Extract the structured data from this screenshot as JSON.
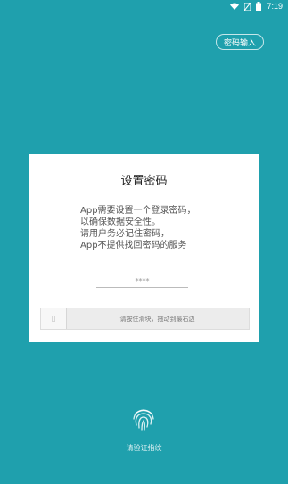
{
  "status_bar": {
    "time": "7:19",
    "icons": [
      "wifi-icon",
      "sim-icon",
      "battery-icon"
    ]
  },
  "header": {
    "password_input_label": "密码输入"
  },
  "dialog": {
    "title": "设置密码",
    "description_lines": [
      "App需要设置一个登录密码，",
      "以确保数据安全性。",
      "请用户务必记住密码，",
      "App不提供找回密码的服务"
    ],
    "password_masked": "****",
    "slider_label": "请按住滑块，拖动到最右边",
    "slider_handle_icon": "slider-handle-icon"
  },
  "fingerprint": {
    "icon": "fingerprint-icon",
    "label": "请验证指纹"
  },
  "colors": {
    "background": "#1fa0ad",
    "dialog": "#ffffff"
  }
}
